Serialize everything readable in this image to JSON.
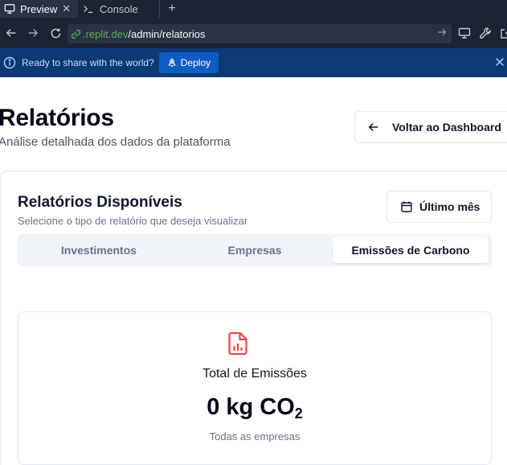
{
  "browser": {
    "tabs": [
      {
        "label": "Preview",
        "icon": "monitor-icon"
      },
      {
        "label": "Console",
        "icon": "terminal-icon"
      }
    ],
    "url_domain": ".replit.dev",
    "url_path": "/admin/relatorios"
  },
  "banner": {
    "message": "Ready to share with the world?",
    "deploy_label": "Deploy",
    "background": "#0b3a75"
  },
  "header": {
    "title": "Relatórios",
    "subtitle": "Análise detalhada dos dados da plataforma",
    "back_label": "Voltar ao Dashboard"
  },
  "reports": {
    "title": "Relatórios Disponíveis",
    "subtitle": "Selecione o tipo de relatório que deseja visualizar",
    "range_label": "Último mês",
    "tabs": [
      {
        "label": "Investimentos",
        "selected": false
      },
      {
        "label": "Empresas",
        "selected": false
      },
      {
        "label": "Emissões de Carbono",
        "selected": true
      }
    ]
  },
  "stat": {
    "title": "Total de Emissões",
    "value": "0 kg CO",
    "value_subscript": "2",
    "note": "Todas as empresas",
    "icon": "file-chart-icon",
    "icon_color": "#ef4444"
  }
}
